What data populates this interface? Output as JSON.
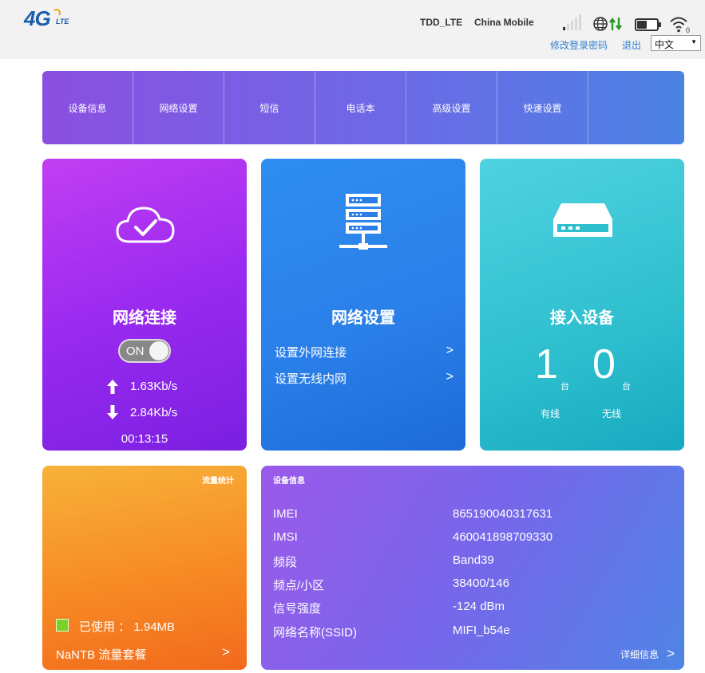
{
  "header": {
    "logo_main": "4G",
    "logo_sub": "LTE",
    "network_type": "TDD_LTE",
    "operator": "China Mobile",
    "change_password_link": "修改登录密码",
    "logout_link": "退出",
    "language_selected": "中文",
    "signal_bars_active": 1,
    "signal_bars_total": 5,
    "icons": [
      "signal-icon",
      "globe-data-icon",
      "battery-icon",
      "wifi-icon"
    ],
    "wifi_clients": "0"
  },
  "nav": {
    "items": [
      "设备信息",
      "网络设置",
      "短信",
      "电话本",
      "高级设置",
      "快速设置"
    ]
  },
  "connection_card": {
    "title": "网络连接",
    "toggle_label": "ON",
    "toggle_on": true,
    "upload_speed": "1.63Kb/s",
    "download_speed": "2.84Kb/s",
    "uptime": "00:13:15",
    "color": "#a92ff0"
  },
  "netset_card": {
    "title": "网络设置",
    "links": [
      "设置外网连接",
      "设置无线内网"
    ],
    "chevron": ">",
    "color": "#2a7ee8"
  },
  "devices_card": {
    "title": "接入设备",
    "wired_count": "1",
    "wireless_count": "0",
    "unit": "台",
    "wired_label": "有线",
    "wireless_label": "无线",
    "color": "#2ebfcf"
  },
  "traffic_card": {
    "title": "流量统计",
    "used_label": "已使用 ：",
    "used_value": "1.94MB",
    "plan_label": "NaNTB 流量套餐",
    "chevron": ">",
    "used_swatch_color": "#7bd12a",
    "color": "#f78a24"
  },
  "info_card": {
    "title": "设备信息",
    "rows": [
      {
        "key": "IMEI",
        "value": "865190040317631"
      },
      {
        "key": "IMSI",
        "value": "460041898709330"
      },
      {
        "key": "频段",
        "value": "Band39"
      },
      {
        "key": "频点/小区",
        "value": "38400/146"
      },
      {
        "key": "信号强度",
        "value": "-124 dBm"
      },
      {
        "key": "网络名称(SSID)",
        "value": "MIFI_b54e"
      }
    ],
    "detail_link": "详细信息",
    "chevron": ">"
  }
}
